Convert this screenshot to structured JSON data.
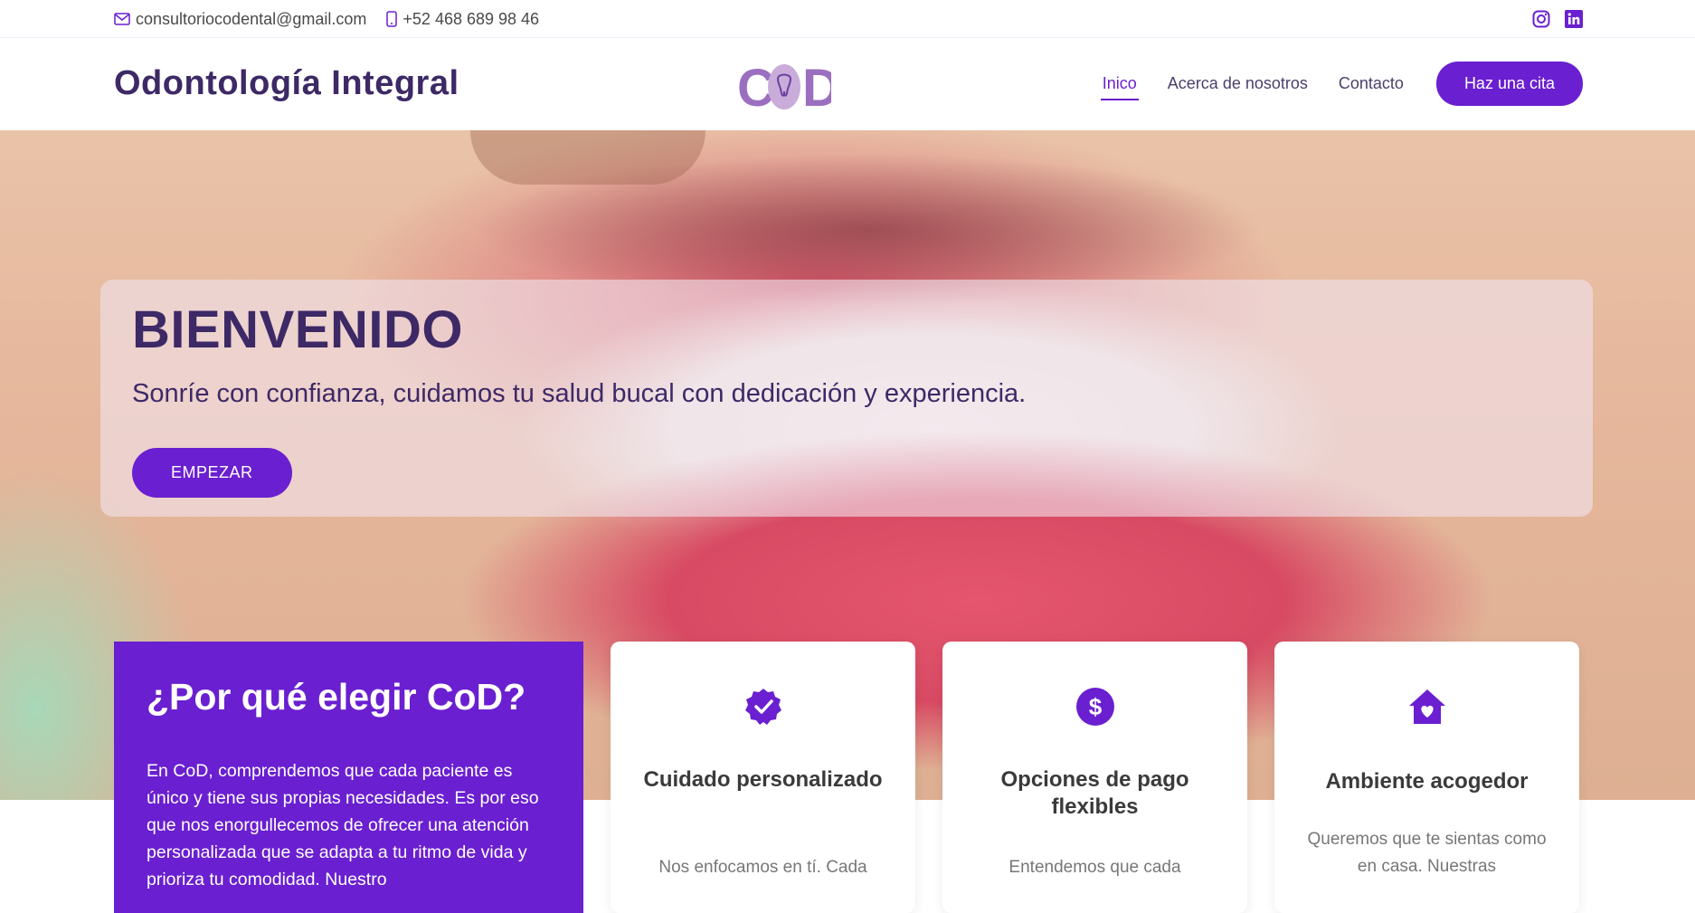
{
  "topbar": {
    "email": "consultoriocodental@gmail.com",
    "phone": "+52 468 689 98 46",
    "icons": [
      "mail-icon",
      "phone-icon",
      "instagram-icon",
      "linkedin-icon"
    ]
  },
  "header": {
    "brand": "Odontología Integral",
    "logo_text": "COD",
    "nav": [
      {
        "label": "Inico",
        "active": true
      },
      {
        "label": "Acerca de nosotros",
        "active": false
      },
      {
        "label": "Contacto",
        "active": false
      }
    ],
    "cta": "Haz una cita"
  },
  "hero": {
    "title": "BIENVENIDO",
    "subtitle": "Sonríe con confianza, cuidamos tu salud bucal con dedicación y experiencia.",
    "button": "EMPEZAR"
  },
  "why": {
    "title": "¿Por qué elegir CoD?",
    "text": "En CoD, comprendemos que cada paciente es único y tiene sus propias necesidades. Es por eso que nos enorgullecemos de ofrecer una atención personalizada que se adapta a tu ritmo de vida y prioriza tu comodidad. Nuestro"
  },
  "cards": [
    {
      "icon": "verified-badge-icon",
      "title": "Cuidado personalizado",
      "text": "Nos enfocamos en tí. Cada"
    },
    {
      "icon": "dollar-icon",
      "title": "Opciones de pago flexibles",
      "text": "Entendemos que cada"
    },
    {
      "icon": "home-heart-icon",
      "title": "Ambiente acogedor",
      "text": "Queremos que te sientas como en casa. Nuestras"
    }
  ],
  "colors": {
    "primary": "#6a1fd0",
    "heading": "#3d2966"
  }
}
